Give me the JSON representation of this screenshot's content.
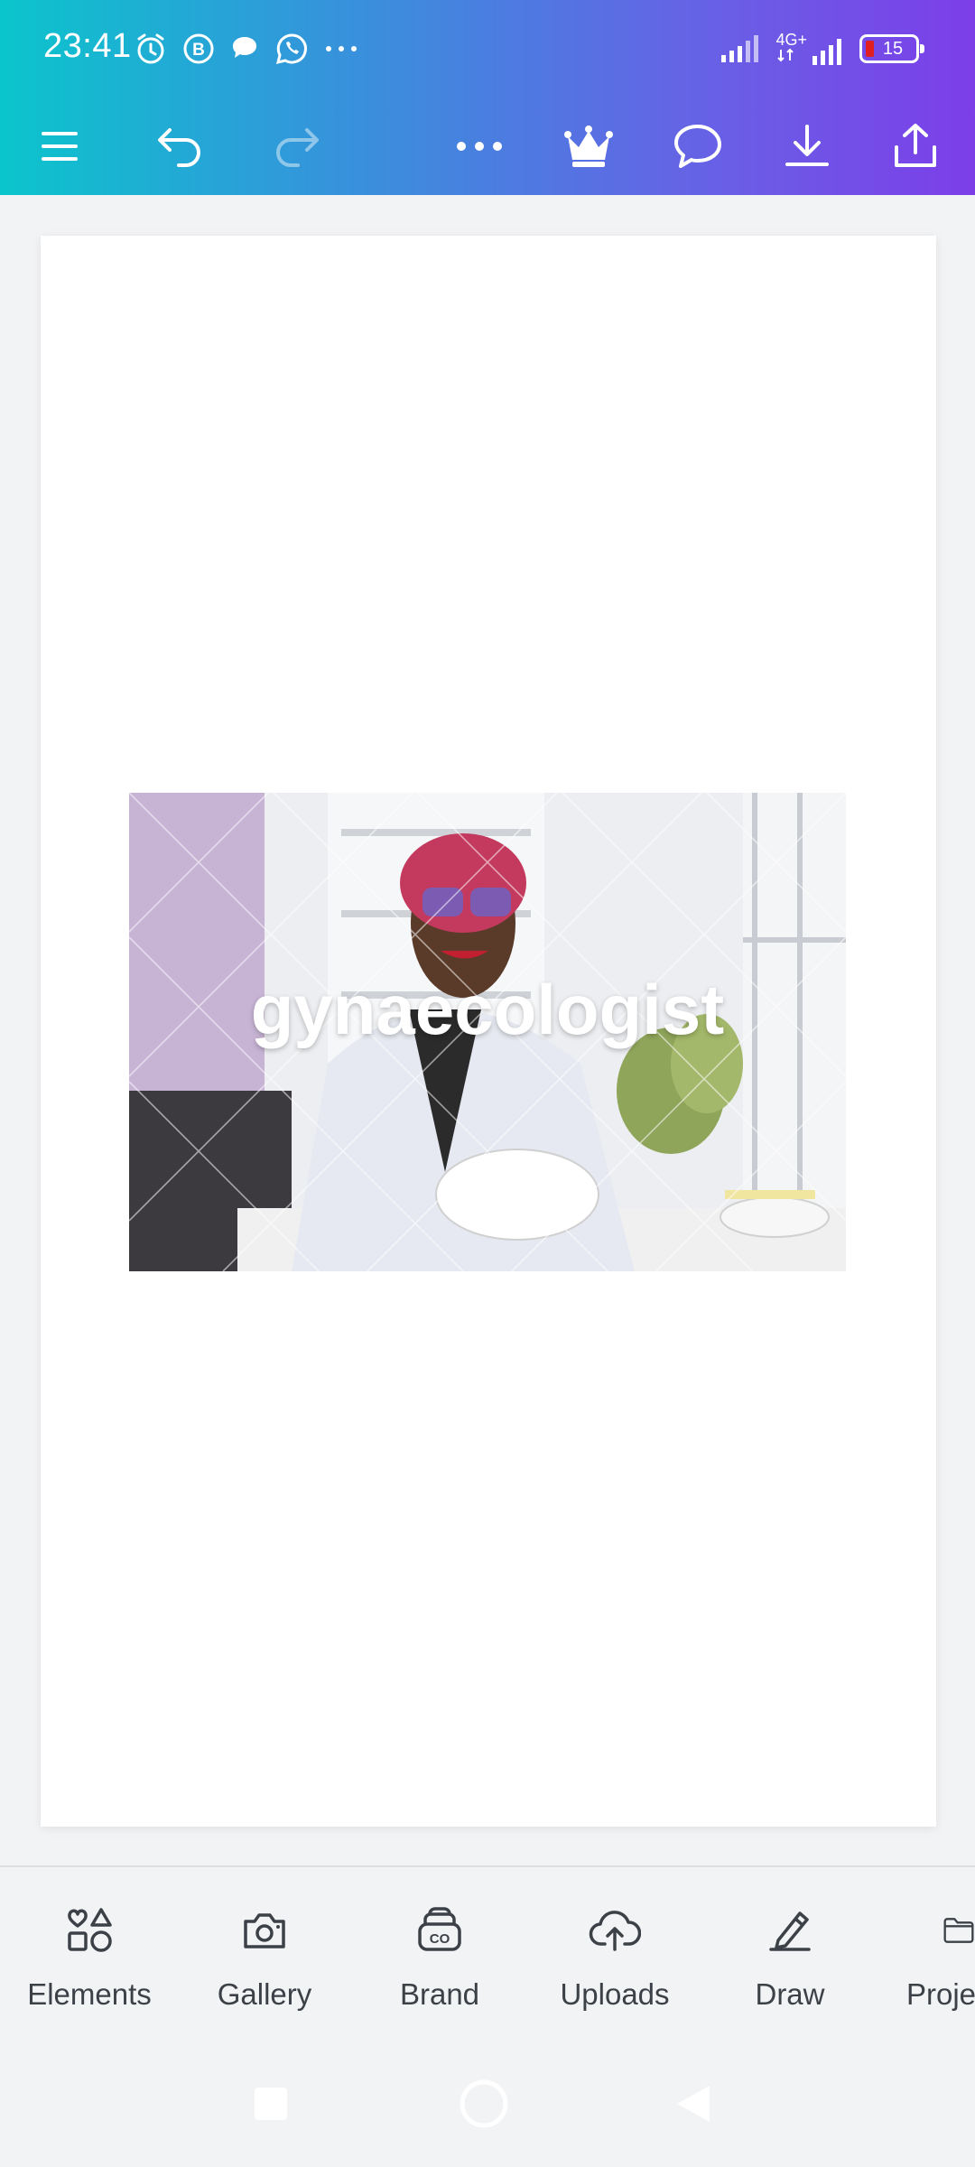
{
  "status_bar": {
    "time": "23:41",
    "network_label_top": "4G+",
    "battery_percent": "15",
    "icons": [
      "alarm-icon",
      "b-circle-icon",
      "message-bubble-icon",
      "whatsapp-icon",
      "more-dots-icon",
      "signal-icon",
      "signal-4g-icon",
      "battery-icon"
    ]
  },
  "toolbar": {
    "icons": [
      "menu-icon",
      "undo-icon",
      "redo-icon",
      "more-icon",
      "crown-icon",
      "comment-icon",
      "download-icon",
      "share-icon"
    ]
  },
  "canvas": {
    "photo_text": "gynaecologist"
  },
  "bottom_nav": {
    "items": [
      {
        "label": "Elements",
        "icon": "elements-icon"
      },
      {
        "label": "Gallery",
        "icon": "camera-icon"
      },
      {
        "label": "Brand",
        "icon": "brand-icon"
      },
      {
        "label": "Uploads",
        "icon": "upload-cloud-icon"
      },
      {
        "label": "Draw",
        "icon": "pen-icon"
      },
      {
        "label": "Proje",
        "icon": "folder-icon"
      }
    ]
  },
  "colors": {
    "gradient_start": "#0bc5cc",
    "gradient_end": "#7c3ee8",
    "page_bg": "#ffffff",
    "canvas_bg": "#f2f3f5"
  }
}
